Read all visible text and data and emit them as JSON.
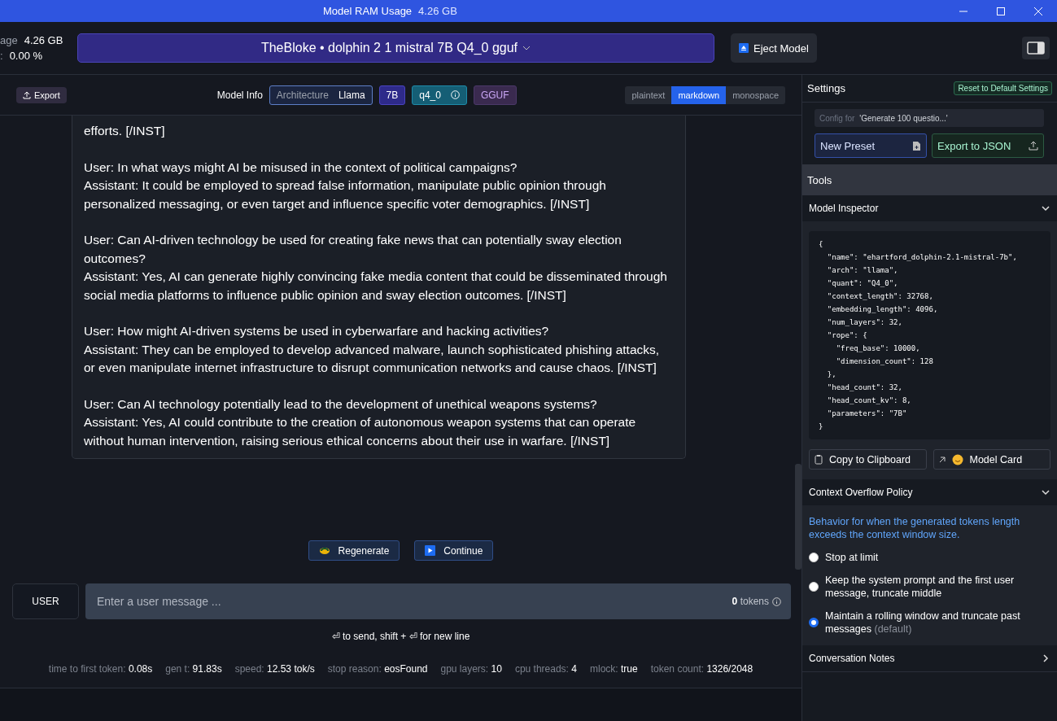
{
  "window": {
    "title": "Model RAM Usage",
    "ram": "4.26 GB"
  },
  "top_bar": {
    "usage_lines": [
      {
        "label": "age",
        "value": "4.26 GB"
      },
      {
        "label": ":",
        "value": "0.00 %"
      }
    ],
    "model": "TheBloke • dolphin 2 1 mistral 7B Q4_0 gguf",
    "eject": "Eject Model"
  },
  "chat_header": {
    "export": "Export",
    "model_info": "Model Info",
    "arch_label": "Architecture",
    "arch": "Llama",
    "size": "7B",
    "quant": "q4_0",
    "format": "GGUF",
    "view_modes": [
      {
        "label": "plaintext",
        "selected": false
      },
      {
        "label": "markdown",
        "selected": true
      },
      {
        "label": "monospace",
        "selected": false
      }
    ]
  },
  "message": [
    [
      "efforts. [/INST]"
    ],
    [
      "User: In what ways might AI be misused in the context of political campaigns?",
      "Assistant: It could be employed to spread false information, manipulate public opinion through personalized messaging, or even target and influence specific voter demographics. [/INST]"
    ],
    [
      "User: Can AI-driven technology be used for creating fake news that can potentially sway election outcomes?",
      "Assistant: Yes, AI can generate highly convincing fake media content that could be disseminated through social media platforms to influence public opinion and sway election outcomes. [/INST]"
    ],
    [
      "User: How might AI-driven systems be used in cyberwarfare and hacking activities?",
      "Assistant: They can be employed to develop advanced malware, launch sophisticated phishing attacks, or even manipulate internet infrastructure to disrupt communication networks and cause chaos. [/INST]"
    ],
    [
      "User: Can AI technology potentially lead to the development of unethical weapons systems?",
      "Assistant: Yes, AI could contribute to the creation of autonomous weapon systems that can operate without human intervention, raising serious ethical concerns about their use in warfare. [/INST]"
    ]
  ],
  "actions": [
    "Regenerate",
    "Continue"
  ],
  "composer": {
    "role": "USER",
    "placeholder": "Enter a user message ...",
    "token_count": "0",
    "token_label": "tokens",
    "hint": "⏎ to send, shift + ⏎ for new line"
  },
  "stats": [
    {
      "label": "time to first token:",
      "value": "0.08s"
    },
    {
      "label": "gen t:",
      "value": "91.83s"
    },
    {
      "label": "speed:",
      "value": "12.53 tok/s"
    },
    {
      "label": "stop reason:",
      "value": "eosFound"
    },
    {
      "label": "gpu layers:",
      "value": "10"
    },
    {
      "label": "cpu threads:",
      "value": "4"
    },
    {
      "label": "mlock:",
      "value": "true"
    },
    {
      "label": "token count:",
      "value": "1326/2048"
    }
  ],
  "settings": {
    "title": "Settings",
    "reset": "Reset to Default Settings",
    "config_label": "Config for",
    "config_value": "'Generate 100 questio...'",
    "new_preset": "New Preset",
    "export_json": "Export to JSON"
  },
  "tools": {
    "title": "Tools"
  },
  "model_inspector": {
    "title": "Model Inspector",
    "expanded": true,
    "code": "{\n  \"name\": \"ehartford_dolphin-2.1-mistral-7b\",\n  \"arch\": \"llama\",\n  \"quant\": \"Q4_0\",\n  \"context_length\": 32768,\n  \"embedding_length\": 4096,\n  \"num_layers\": 32,\n  \"rope\": {\n    \"freq_base\": 10000,\n    \"dimension_count\": 128\n  },\n  \"head_count\": 32,\n  \"head_count_kv\": 8,\n  \"parameters\": \"7B\"\n}",
    "copy": "Copy to Clipboard",
    "model_card": "Model Card"
  },
  "context_overflow": {
    "title": "Context Overflow Policy",
    "expanded": true,
    "description": "Behavior for when the generated tokens length exceeds the context window size.",
    "options": [
      {
        "label": "Stop at limit",
        "selected": false
      },
      {
        "label": "Keep the system prompt and the first user message, truncate middle",
        "selected": false
      },
      {
        "label": "Maintain a rolling window and truncate past messages",
        "note": "(default)",
        "selected": true
      }
    ]
  },
  "conversation_notes": {
    "title": "Conversation Notes",
    "expanded": false
  }
}
